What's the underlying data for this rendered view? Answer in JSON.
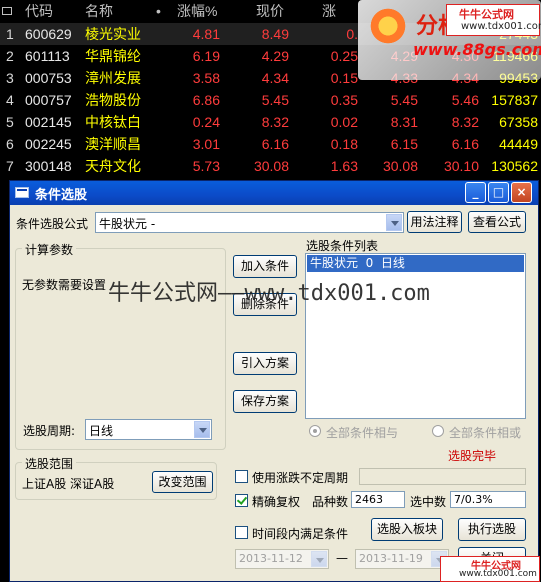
{
  "table": {
    "headers": {
      "code": "代码",
      "name": "名称",
      "dot": "•",
      "pct": "涨幅%",
      "price": "现价",
      "chg": "涨"
    },
    "rows": [
      {
        "idx": "1",
        "code": "600629",
        "name": "棱光实业",
        "pct": "4.81",
        "price": "8.49",
        "chg": "0.",
        "buy": "",
        "sell": "",
        "vol": "27443"
      },
      {
        "idx": "2",
        "code": "601113",
        "name": "华鼎锦纶",
        "pct": "6.19",
        "price": "4.29",
        "chg": "0.25",
        "buy": "4.29",
        "sell": "4.30",
        "vol": "119466"
      },
      {
        "idx": "3",
        "code": "000753",
        "name": "漳州发展",
        "pct": "3.58",
        "price": "4.34",
        "chg": "0.15",
        "buy": "4.33",
        "sell": "4.34",
        "vol": "99453"
      },
      {
        "idx": "4",
        "code": "000757",
        "name": "浩物股份",
        "pct": "6.86",
        "price": "5.45",
        "chg": "0.35",
        "buy": "5.45",
        "sell": "5.46",
        "vol": "157837"
      },
      {
        "idx": "5",
        "code": "002145",
        "name": "中核钛白",
        "pct": "0.24",
        "price": "8.32",
        "chg": "0.02",
        "buy": "8.31",
        "sell": "8.32",
        "vol": "67358"
      },
      {
        "idx": "6",
        "code": "002245",
        "name": "澳洋顺昌",
        "pct": "3.01",
        "price": "6.16",
        "chg": "0.18",
        "buy": "6.15",
        "sell": "6.16",
        "vol": "44449"
      },
      {
        "idx": "7",
        "code": "300148",
        "name": "天舟文化",
        "pct": "5.73",
        "price": "30.08",
        "chg": "1.63",
        "buy": "30.08",
        "sell": "30.10",
        "vol": "130562"
      }
    ]
  },
  "logo": {
    "brand": "分析",
    "site": "www.88gs.com",
    "stamp_name": "牛牛公式网",
    "stamp_url": "www.tdx001.com"
  },
  "dialog": {
    "title": "条件选股",
    "formula_label": "条件选股公式",
    "formula_value": "牛股状元 -",
    "usage_button": "用法注释",
    "view_formula_button": "查看公式",
    "params_group": "计算参数",
    "no_params": "无参数需要设置",
    "add_condition": "加入条件",
    "delete_condition": "删除条件",
    "import_plan": "引入方案",
    "save_plan": "保存方案",
    "condition_list_label": "选股条件列表",
    "condition_items": [
      "牛股状元  0  日线"
    ],
    "period_label": "选股周期:",
    "period_value": "日线",
    "all_and": "全部条件相与",
    "all_or": "全部条件相或",
    "status": "选股完毕",
    "range_group": "选股范围",
    "range_value": "上证A股 深证A股",
    "change_range": "改变范围",
    "use_uncertain": "使用涨跌不定周期",
    "precise_rights": "精确复权",
    "count_label": "品种数",
    "count_value": "2463",
    "selected_label": "选中数",
    "selected_value": "7/0.3%",
    "time_range": "时间段内满足条件",
    "to_block": "选股入板块",
    "execute": "执行选股",
    "date_from": "2013-11-12",
    "dash": "—",
    "date_to": "2013-11-19",
    "close_partial": "关闭"
  },
  "watermark": "牛牛公式网——www.tdx001.com",
  "colors": {
    "title_bar": "#0b4bc8",
    "dialog_bg": "#ece9d8",
    "up_red": "#ff3c3c",
    "name_yellow": "#ffff00",
    "status_red": "#cc0000",
    "list_select": "#316ac5"
  }
}
